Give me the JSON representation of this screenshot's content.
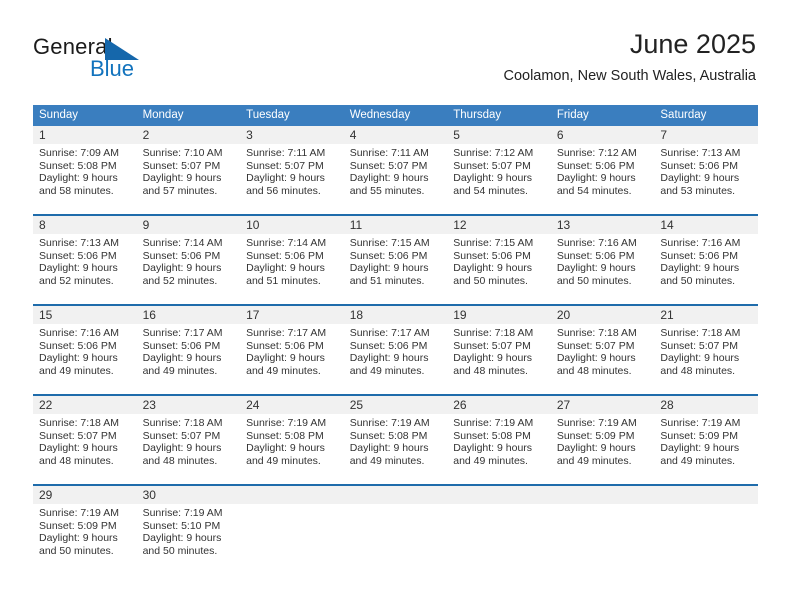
{
  "branding": {
    "logo_primary": "General",
    "logo_secondary": "Blue",
    "logo_shape": "blue-triangle",
    "logo_primary_color": "#1b1b1b",
    "logo_secondary_color": "#1273bd"
  },
  "header": {
    "title": "June 2025",
    "subtitle": "Coolamon, New South Wales, Australia"
  },
  "theme": {
    "header_bar_color": "#3a7ebf",
    "week_divider_color": "#1f6cab",
    "daynum_strip_color": "#f1f1f1",
    "cell_background": "#ffffff",
    "text_color": "#333333"
  },
  "calendar": {
    "columns": [
      "Sunday",
      "Monday",
      "Tuesday",
      "Wednesday",
      "Thursday",
      "Friday",
      "Saturday"
    ],
    "weeks": [
      [
        {
          "day": "1",
          "sunrise": "Sunrise: 7:09 AM",
          "sunset": "Sunset: 5:08 PM",
          "daylight1": "Daylight: 9 hours",
          "daylight2": "and 58 minutes."
        },
        {
          "day": "2",
          "sunrise": "Sunrise: 7:10 AM",
          "sunset": "Sunset: 5:07 PM",
          "daylight1": "Daylight: 9 hours",
          "daylight2": "and 57 minutes."
        },
        {
          "day": "3",
          "sunrise": "Sunrise: 7:11 AM",
          "sunset": "Sunset: 5:07 PM",
          "daylight1": "Daylight: 9 hours",
          "daylight2": "and 56 minutes."
        },
        {
          "day": "4",
          "sunrise": "Sunrise: 7:11 AM",
          "sunset": "Sunset: 5:07 PM",
          "daylight1": "Daylight: 9 hours",
          "daylight2": "and 55 minutes."
        },
        {
          "day": "5",
          "sunrise": "Sunrise: 7:12 AM",
          "sunset": "Sunset: 5:07 PM",
          "daylight1": "Daylight: 9 hours",
          "daylight2": "and 54 minutes."
        },
        {
          "day": "6",
          "sunrise": "Sunrise: 7:12 AM",
          "sunset": "Sunset: 5:06 PM",
          "daylight1": "Daylight: 9 hours",
          "daylight2": "and 54 minutes."
        },
        {
          "day": "7",
          "sunrise": "Sunrise: 7:13 AM",
          "sunset": "Sunset: 5:06 PM",
          "daylight1": "Daylight: 9 hours",
          "daylight2": "and 53 minutes."
        }
      ],
      [
        {
          "day": "8",
          "sunrise": "Sunrise: 7:13 AM",
          "sunset": "Sunset: 5:06 PM",
          "daylight1": "Daylight: 9 hours",
          "daylight2": "and 52 minutes."
        },
        {
          "day": "9",
          "sunrise": "Sunrise: 7:14 AM",
          "sunset": "Sunset: 5:06 PM",
          "daylight1": "Daylight: 9 hours",
          "daylight2": "and 52 minutes."
        },
        {
          "day": "10",
          "sunrise": "Sunrise: 7:14 AM",
          "sunset": "Sunset: 5:06 PM",
          "daylight1": "Daylight: 9 hours",
          "daylight2": "and 51 minutes."
        },
        {
          "day": "11",
          "sunrise": "Sunrise: 7:15 AM",
          "sunset": "Sunset: 5:06 PM",
          "daylight1": "Daylight: 9 hours",
          "daylight2": "and 51 minutes."
        },
        {
          "day": "12",
          "sunrise": "Sunrise: 7:15 AM",
          "sunset": "Sunset: 5:06 PM",
          "daylight1": "Daylight: 9 hours",
          "daylight2": "and 50 minutes."
        },
        {
          "day": "13",
          "sunrise": "Sunrise: 7:16 AM",
          "sunset": "Sunset: 5:06 PM",
          "daylight1": "Daylight: 9 hours",
          "daylight2": "and 50 minutes."
        },
        {
          "day": "14",
          "sunrise": "Sunrise: 7:16 AM",
          "sunset": "Sunset: 5:06 PM",
          "daylight1": "Daylight: 9 hours",
          "daylight2": "and 50 minutes."
        }
      ],
      [
        {
          "day": "15",
          "sunrise": "Sunrise: 7:16 AM",
          "sunset": "Sunset: 5:06 PM",
          "daylight1": "Daylight: 9 hours",
          "daylight2": "and 49 minutes."
        },
        {
          "day": "16",
          "sunrise": "Sunrise: 7:17 AM",
          "sunset": "Sunset: 5:06 PM",
          "daylight1": "Daylight: 9 hours",
          "daylight2": "and 49 minutes."
        },
        {
          "day": "17",
          "sunrise": "Sunrise: 7:17 AM",
          "sunset": "Sunset: 5:06 PM",
          "daylight1": "Daylight: 9 hours",
          "daylight2": "and 49 minutes."
        },
        {
          "day": "18",
          "sunrise": "Sunrise: 7:17 AM",
          "sunset": "Sunset: 5:06 PM",
          "daylight1": "Daylight: 9 hours",
          "daylight2": "and 49 minutes."
        },
        {
          "day": "19",
          "sunrise": "Sunrise: 7:18 AM",
          "sunset": "Sunset: 5:07 PM",
          "daylight1": "Daylight: 9 hours",
          "daylight2": "and 48 minutes."
        },
        {
          "day": "20",
          "sunrise": "Sunrise: 7:18 AM",
          "sunset": "Sunset: 5:07 PM",
          "daylight1": "Daylight: 9 hours",
          "daylight2": "and 48 minutes."
        },
        {
          "day": "21",
          "sunrise": "Sunrise: 7:18 AM",
          "sunset": "Sunset: 5:07 PM",
          "daylight1": "Daylight: 9 hours",
          "daylight2": "and 48 minutes."
        }
      ],
      [
        {
          "day": "22",
          "sunrise": "Sunrise: 7:18 AM",
          "sunset": "Sunset: 5:07 PM",
          "daylight1": "Daylight: 9 hours",
          "daylight2": "and 48 minutes."
        },
        {
          "day": "23",
          "sunrise": "Sunrise: 7:18 AM",
          "sunset": "Sunset: 5:07 PM",
          "daylight1": "Daylight: 9 hours",
          "daylight2": "and 48 minutes."
        },
        {
          "day": "24",
          "sunrise": "Sunrise: 7:19 AM",
          "sunset": "Sunset: 5:08 PM",
          "daylight1": "Daylight: 9 hours",
          "daylight2": "and 49 minutes."
        },
        {
          "day": "25",
          "sunrise": "Sunrise: 7:19 AM",
          "sunset": "Sunset: 5:08 PM",
          "daylight1": "Daylight: 9 hours",
          "daylight2": "and 49 minutes."
        },
        {
          "day": "26",
          "sunrise": "Sunrise: 7:19 AM",
          "sunset": "Sunset: 5:08 PM",
          "daylight1": "Daylight: 9 hours",
          "daylight2": "and 49 minutes."
        },
        {
          "day": "27",
          "sunrise": "Sunrise: 7:19 AM",
          "sunset": "Sunset: 5:09 PM",
          "daylight1": "Daylight: 9 hours",
          "daylight2": "and 49 minutes."
        },
        {
          "day": "28",
          "sunrise": "Sunrise: 7:19 AM",
          "sunset": "Sunset: 5:09 PM",
          "daylight1": "Daylight: 9 hours",
          "daylight2": "and 49 minutes."
        }
      ],
      [
        {
          "day": "29",
          "sunrise": "Sunrise: 7:19 AM",
          "sunset": "Sunset: 5:09 PM",
          "daylight1": "Daylight: 9 hours",
          "daylight2": "and 50 minutes."
        },
        {
          "day": "30",
          "sunrise": "Sunrise: 7:19 AM",
          "sunset": "Sunset: 5:10 PM",
          "daylight1": "Daylight: 9 hours",
          "daylight2": "and 50 minutes."
        },
        {
          "day": "",
          "sunrise": "",
          "sunset": "",
          "daylight1": "",
          "daylight2": ""
        },
        {
          "day": "",
          "sunrise": "",
          "sunset": "",
          "daylight1": "",
          "daylight2": ""
        },
        {
          "day": "",
          "sunrise": "",
          "sunset": "",
          "daylight1": "",
          "daylight2": ""
        },
        {
          "day": "",
          "sunrise": "",
          "sunset": "",
          "daylight1": "",
          "daylight2": ""
        },
        {
          "day": "",
          "sunrise": "",
          "sunset": "",
          "daylight1": "",
          "daylight2": ""
        }
      ]
    ]
  }
}
